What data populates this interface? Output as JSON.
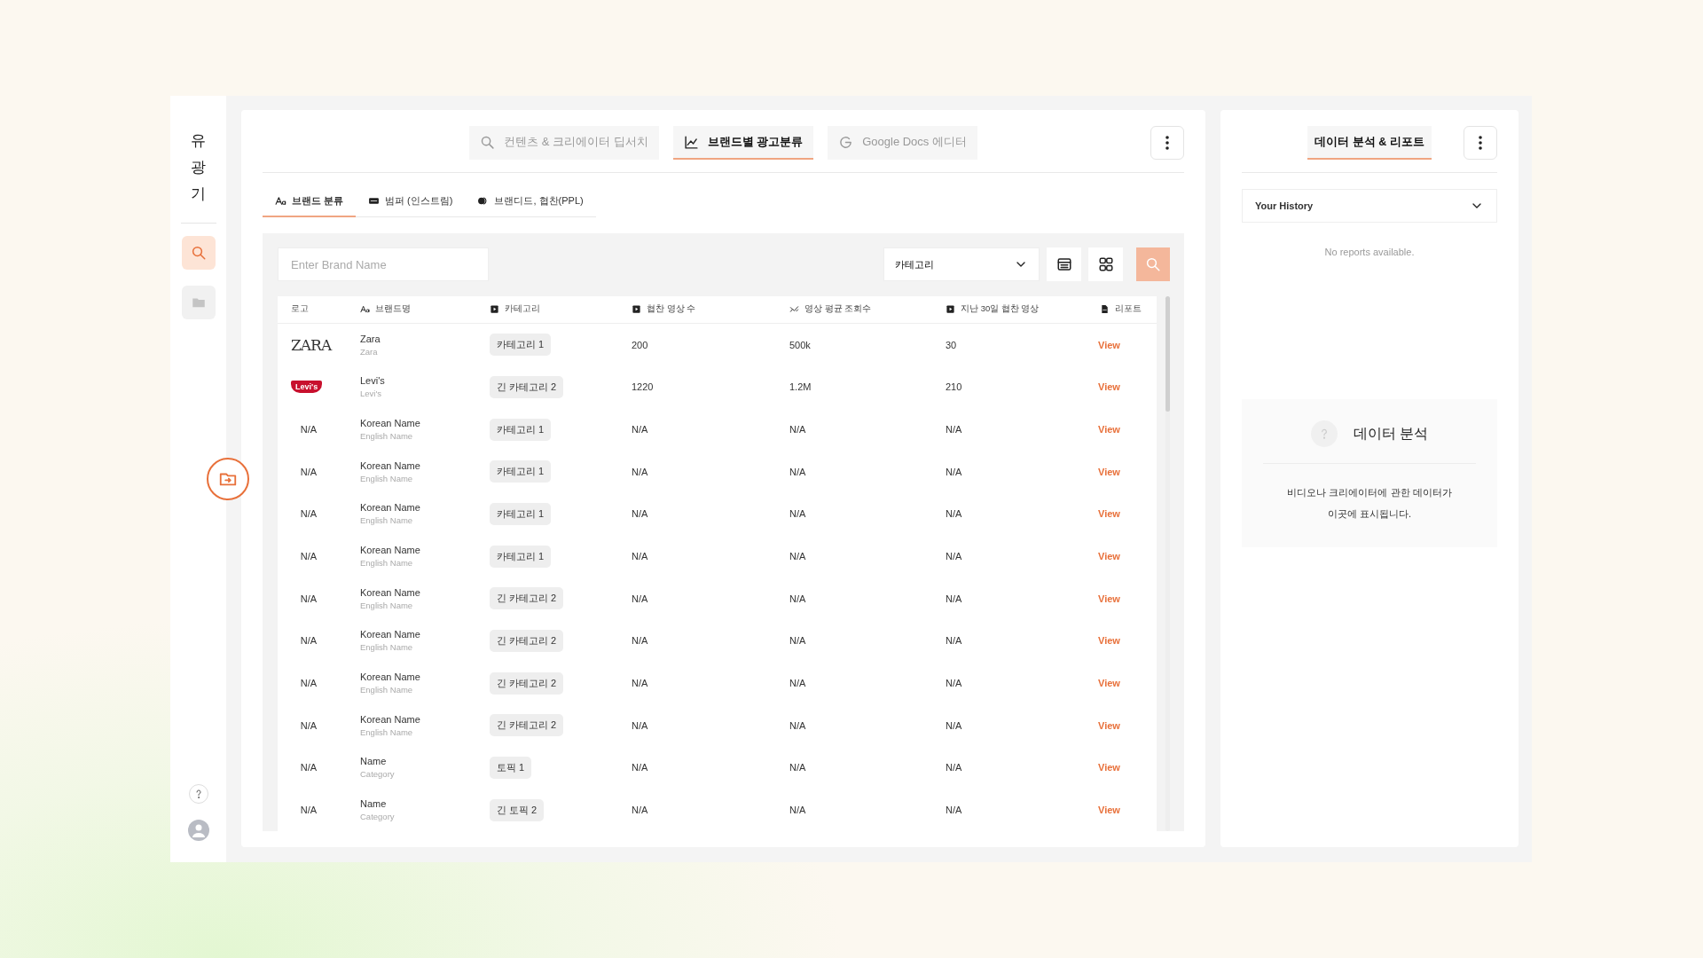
{
  "sidebar": {
    "logo": "유광기",
    "items": [
      {
        "kind": "search",
        "selected": true
      },
      {
        "kind": "folder",
        "selected": false
      }
    ]
  },
  "main": {
    "tabs": [
      {
        "kind": "search",
        "label": "컨텐츠 & 크리에이터 딥서치",
        "selected": false
      },
      {
        "kind": "chart",
        "label": "브랜드별 광고분류",
        "selected": true
      },
      {
        "kind": "google",
        "label": "Google Docs 에디터",
        "selected": false
      }
    ],
    "subtabs": [
      {
        "kind": "text",
        "label": "브랜드 분류",
        "selected": true
      },
      {
        "kind": "ad",
        "label": "범퍼 (인스트림)",
        "selected": false
      },
      {
        "kind": "coin",
        "label": "브랜디드, 협찬(PPL)",
        "selected": false
      }
    ],
    "filter": {
      "placeholder": "Enter Brand Name",
      "category": "카테고리"
    },
    "table": {
      "columns": [
        {
          "kind": "none",
          "label": "로고"
        },
        {
          "kind": "text",
          "label": "브랜드명"
        },
        {
          "kind": "play",
          "label": "카테고리"
        },
        {
          "kind": "play",
          "label": "협찬 영상 수"
        },
        {
          "kind": "trend",
          "label": "영상 평균 조회수"
        },
        {
          "kind": "play",
          "label": "지난 30일 협찬 영상"
        },
        {
          "kind": "doc",
          "label": "리포트"
        }
      ],
      "rows": [
        {
          "logo": {
            "kind": "wordmark",
            "text": "ZARA"
          },
          "name": "Zara",
          "subname": "Zara",
          "category": "카테고리 1",
          "count": "200",
          "views": "500k",
          "last30": "30",
          "report": "View"
        },
        {
          "logo": {
            "kind": "badge",
            "text": "Levi's"
          },
          "name": "Levi's",
          "subname": "Levi's",
          "category": "긴 카테고리 2",
          "count": "1220",
          "views": "1.2M",
          "last30": "210",
          "report": "View"
        },
        {
          "logo": {
            "kind": "none",
            "text": "N/A"
          },
          "name": "Korean Name",
          "subname": "English Name",
          "category": "카테고리 1",
          "count": "N/A",
          "views": "N/A",
          "last30": "N/A",
          "report": "View"
        },
        {
          "logo": {
            "kind": "none",
            "text": "N/A"
          },
          "name": "Korean Name",
          "subname": "English Name",
          "category": "카테고리 1",
          "count": "N/A",
          "views": "N/A",
          "last30": "N/A",
          "report": "View"
        },
        {
          "logo": {
            "kind": "none",
            "text": "N/A"
          },
          "name": "Korean Name",
          "subname": "English Name",
          "category": "카테고리 1",
          "count": "N/A",
          "views": "N/A",
          "last30": "N/A",
          "report": "View"
        },
        {
          "logo": {
            "kind": "none",
            "text": "N/A"
          },
          "name": "Korean Name",
          "subname": "English Name",
          "category": "카테고리 1",
          "count": "N/A",
          "views": "N/A",
          "last30": "N/A",
          "report": "View"
        },
        {
          "logo": {
            "kind": "none",
            "text": "N/A"
          },
          "name": "Korean Name",
          "subname": "English Name",
          "category": "긴 카테고리 2",
          "count": "N/A",
          "views": "N/A",
          "last30": "N/A",
          "report": "View"
        },
        {
          "logo": {
            "kind": "none",
            "text": "N/A"
          },
          "name": "Korean Name",
          "subname": "English Name",
          "category": "긴 카테고리 2",
          "count": "N/A",
          "views": "N/A",
          "last30": "N/A",
          "report": "View"
        },
        {
          "logo": {
            "kind": "none",
            "text": "N/A"
          },
          "name": "Korean Name",
          "subname": "English Name",
          "category": "긴 카테고리 2",
          "count": "N/A",
          "views": "N/A",
          "last30": "N/A",
          "report": "View"
        },
        {
          "logo": {
            "kind": "none",
            "text": "N/A"
          },
          "name": "Korean Name",
          "subname": "English Name",
          "category": "긴 카테고리 2",
          "count": "N/A",
          "views": "N/A",
          "last30": "N/A",
          "report": "View"
        },
        {
          "logo": {
            "kind": "none",
            "text": "N/A"
          },
          "name": "Name",
          "subname": "Category",
          "category": "토픽 1",
          "count": "N/A",
          "views": "N/A",
          "last30": "N/A",
          "report": "View"
        },
        {
          "logo": {
            "kind": "none",
            "text": "N/A"
          },
          "name": "Name",
          "subname": "Category",
          "category": "긴 토픽 2",
          "count": "N/A",
          "views": "N/A",
          "last30": "N/A",
          "report": "View"
        }
      ]
    }
  },
  "right": {
    "tabs": [
      {
        "label": "데이터 분석 & 리포트",
        "selected": true
      }
    ],
    "history": "Your History",
    "empty": "No reports available.",
    "info": {
      "title": "데이터 분석",
      "text": "비디오나 크리에이터에 관한 데이터가 이곳에 표시됩니다."
    }
  }
}
